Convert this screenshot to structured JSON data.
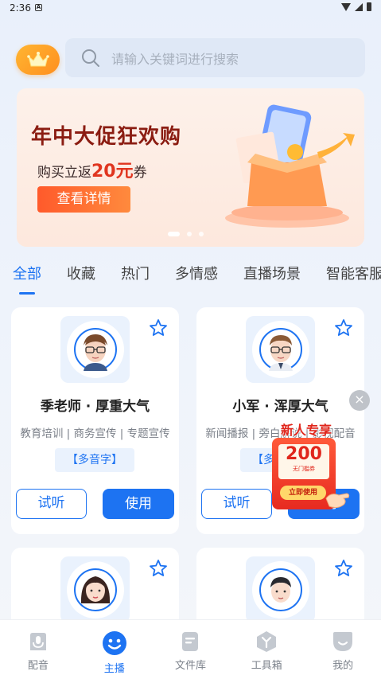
{
  "status_bar": {
    "time": "2:36",
    "notif_letter": "A"
  },
  "search": {
    "placeholder": "请输入关键词进行搜索"
  },
  "banner": {
    "title": "年中大促狂欢购",
    "subtitle_prefix": "购买立返",
    "subtitle_highlight": "20元",
    "subtitle_suffix": "券",
    "cta_label": "查看详情",
    "slide_count": 3,
    "active_slide": 1
  },
  "tabs": [
    {
      "label": "全部",
      "active": true
    },
    {
      "label": "收藏",
      "active": false
    },
    {
      "label": "热门",
      "active": false
    },
    {
      "label": "多情感",
      "active": false
    },
    {
      "label": "直播场景",
      "active": false
    },
    {
      "label": "智能客服",
      "active": false
    }
  ],
  "cards": [
    {
      "name": "季老师 · 厚重大气",
      "tags": "教育培训 | 商务宣传 | 专题宣传",
      "badge": "【多音字】",
      "try_label": "试听",
      "use_label": "使用"
    },
    {
      "name": "小军 · 浑厚大气",
      "tags": "新闻播报 | 旁白解说 | 影视配音",
      "badge": "【多音字】",
      "try_label": "试听",
      "use_label": "使用"
    },
    {
      "name": "",
      "tags": "",
      "badge": "",
      "try_label": "",
      "use_label": ""
    },
    {
      "name": "",
      "tags": "",
      "badge": "",
      "try_label": "",
      "use_label": ""
    }
  ],
  "coupon_popup": {
    "title": "新人专享",
    "amount": "200",
    "amount_sub": "无门槛券",
    "cta": "立即使用",
    "close_symbol": "×"
  },
  "bottom_nav": [
    {
      "label": "配音",
      "icon": "mic-icon",
      "active": false
    },
    {
      "label": "主播",
      "icon": "smiley-icon",
      "active": true
    },
    {
      "label": "文件库",
      "icon": "file-icon",
      "active": false
    },
    {
      "label": "工具箱",
      "icon": "toolbox-icon",
      "active": false
    },
    {
      "label": "我的",
      "icon": "profile-icon",
      "active": false
    }
  ],
  "colors": {
    "accent": "#1d73f2",
    "banner_cta": "#ff6a30",
    "coupon_red": "#e0261c"
  }
}
